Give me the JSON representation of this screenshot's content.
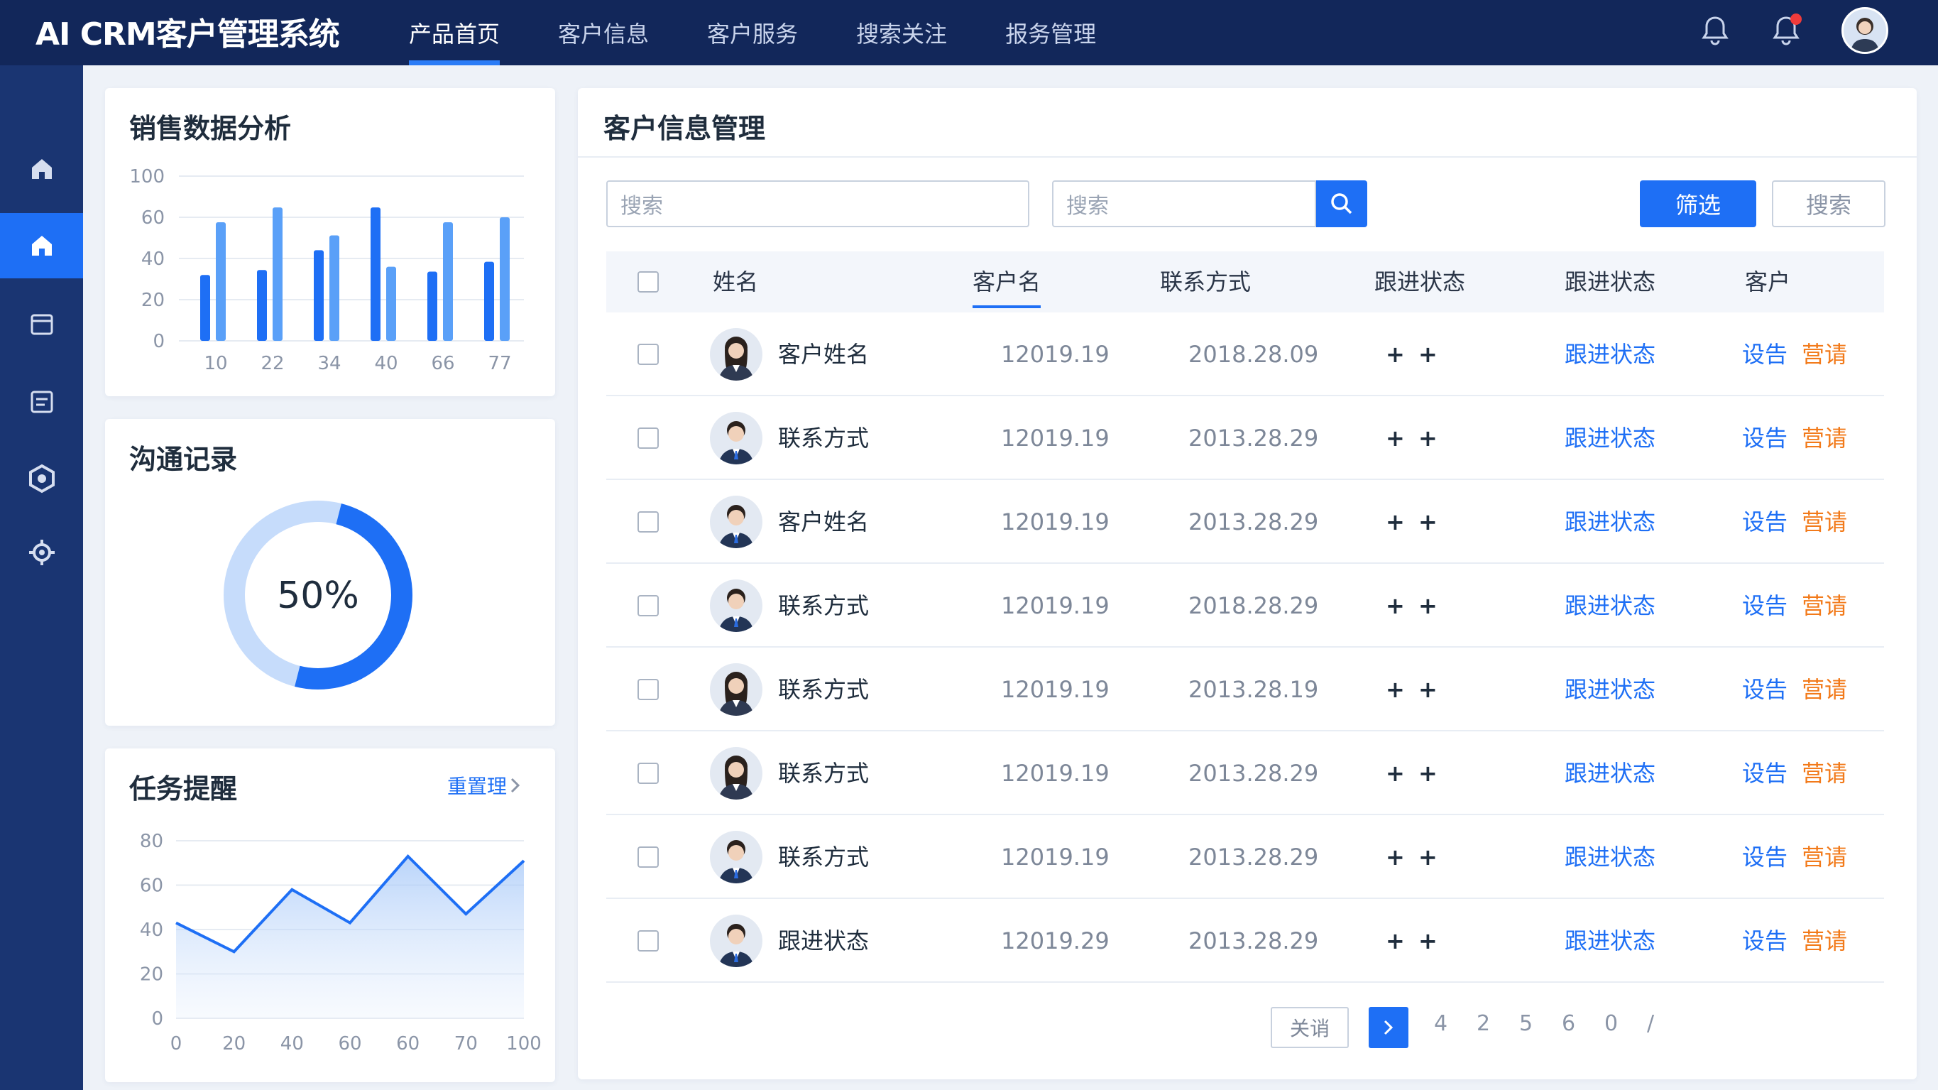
{
  "app": {
    "title": "AI CRM客户管理系统"
  },
  "nav": [
    {
      "label": "产品首页",
      "active": true
    },
    {
      "label": "客户信息",
      "active": false
    },
    {
      "label": "客户服务",
      "active": false
    },
    {
      "label": "搜索关注",
      "active": false
    },
    {
      "label": "报务管理",
      "active": false
    }
  ],
  "top_icons": [
    "bell-icon",
    "notification-bell-icon",
    "user-avatar"
  ],
  "sidebar": {
    "items": [
      "home-icon",
      "home-icon",
      "calendar-icon",
      "list-icon",
      "hexagon-settings-icon",
      "gear-icon"
    ],
    "active_index": 1
  },
  "sales_card": {
    "title": "销售数据分析",
    "chart_data": {
      "type": "bar",
      "categories": [
        "10",
        "22",
        "34",
        "40",
        "66",
        "77"
      ],
      "yticks": [
        "100",
        "60",
        "40",
        "20",
        "0"
      ],
      "series": [
        {
          "values": [
            40,
            43,
            55,
            81,
            42,
            48
          ],
          "color": "#1e6ff5"
        },
        {
          "values": [
            72,
            81,
            64,
            45,
            72,
            75
          ],
          "color": "#5aa0f8"
        }
      ],
      "grid": true
    }
  },
  "comm_card": {
    "title": "沟通记录",
    "chart_data": {
      "type": "pie",
      "values": [
        50,
        50
      ],
      "center_label": "50%",
      "colors": [
        "#1e6ff5",
        "#c6dcfb"
      ]
    }
  },
  "task_card": {
    "title": "任务提醒",
    "link": "重置理",
    "chart_data": {
      "type": "area",
      "x": [
        "0",
        "20",
        "40",
        "60",
        "60",
        "70",
        "100"
      ],
      "y": [
        43,
        30,
        58,
        43,
        73,
        47,
        71
      ],
      "yticks": [
        "80",
        "60",
        "40",
        "20",
        "0"
      ],
      "ylim": [
        0,
        80
      ],
      "grid": true
    }
  },
  "customer_panel": {
    "title": "客户信息管理",
    "search1_placeholder": "搜索",
    "search2_placeholder": "搜索",
    "filter_label": "筛选",
    "search_label": "搜索",
    "headers": [
      "姓名",
      "客户名",
      "联系方式",
      "跟进状态",
      "跟进状态",
      "客户"
    ],
    "rows": [
      {
        "name": "客户姓名",
        "code": "12019.19",
        "date": "2018.28.09",
        "status": "+ +",
        "follow": "跟进状态",
        "action1": "设告",
        "action2": "营请",
        "avatar_gender": "female"
      },
      {
        "name": "联系方式",
        "code": "12019.19",
        "date": "2013.28.29",
        "status": "+ +",
        "follow": "跟进状态",
        "action1": "设告",
        "action2": "营请",
        "avatar_gender": "male"
      },
      {
        "name": "客户姓名",
        "code": "12019.19",
        "date": "2013.28.29",
        "status": "+ +",
        "follow": "跟进状态",
        "action1": "设告",
        "action2": "营请",
        "avatar_gender": "male"
      },
      {
        "name": "联系方式",
        "code": "12019.19",
        "date": "2018.28.29",
        "status": "+ +",
        "follow": "跟进状态",
        "action1": "设告",
        "action2": "营请",
        "avatar_gender": "male"
      },
      {
        "name": "联系方式",
        "code": "12019.19",
        "date": "2013.28.19",
        "status": "+ +",
        "follow": "跟进状态",
        "action1": "设告",
        "action2": "营请",
        "avatar_gender": "female"
      },
      {
        "name": "联系方式",
        "code": "12019.19",
        "date": "2013.28.29",
        "status": "+ +",
        "follow": "跟进状态",
        "action1": "设告",
        "action2": "营请",
        "avatar_gender": "female"
      },
      {
        "name": "联系方式",
        "code": "12019.19",
        "date": "2013.28.29",
        "status": "+ +",
        "follow": "跟进状态",
        "action1": "设告",
        "action2": "营请",
        "avatar_gender": "male"
      },
      {
        "name": "跟进状态",
        "code": "12019.29",
        "date": "2013.28.29",
        "status": "+ +",
        "follow": "跟进状态",
        "action1": "设告",
        "action2": "营请",
        "avatar_gender": "male"
      }
    ],
    "pager": {
      "prev_label": "关诮",
      "pages": [
        "4",
        "2",
        "5",
        "6",
        "0",
        "/"
      ]
    }
  },
  "colors": {
    "topbar": "#12275a",
    "sidebar": "#1a3572",
    "accent": "#1e6ff5",
    "orange": "#f27a1a"
  }
}
